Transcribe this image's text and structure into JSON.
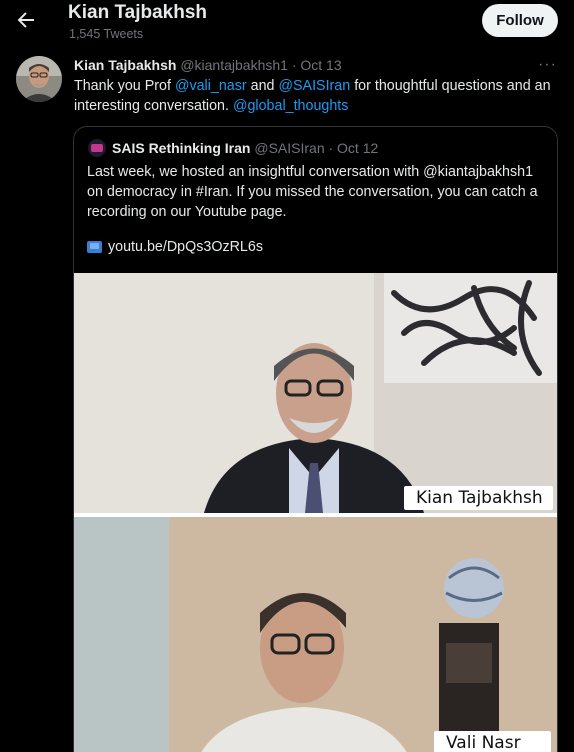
{
  "header": {
    "profile_name": "Kian Tajbakhsh",
    "tweet_count": "1,545 Tweets",
    "follow_label": "Follow"
  },
  "tweet": {
    "author_name": "Kian Tajbakhsh",
    "handle_date": "@kiantajbakhsh1 · Oct 13",
    "more_label": "···",
    "text_pre": "Thank you Prof ",
    "mention1": "@vali_nasr",
    "text_mid": " and ",
    "mention2": "@SAISIran",
    "text_post": " for thoughtful questions and an interesting conversation. ",
    "mention3": "@global_thoughts"
  },
  "quoted": {
    "author_name": "SAIS Rethinking Iran",
    "handle_date": "@SAISIran · Oct 12",
    "text": "Last week, we hosted an insightful conversation with @kiantajbakhsh1 on democracy in #Iran. If you missed the conversation, you can catch a recording on our Youtube page.",
    "link_text": "youtu.be/DpQs3OzRL6s"
  },
  "video": {
    "caption_top": "Kian Tajbakhsh",
    "caption_bottom": "Vali Nasr"
  },
  "colors": {
    "background": "#000000",
    "link": "#1d9bf0",
    "muted": "#71767b"
  }
}
